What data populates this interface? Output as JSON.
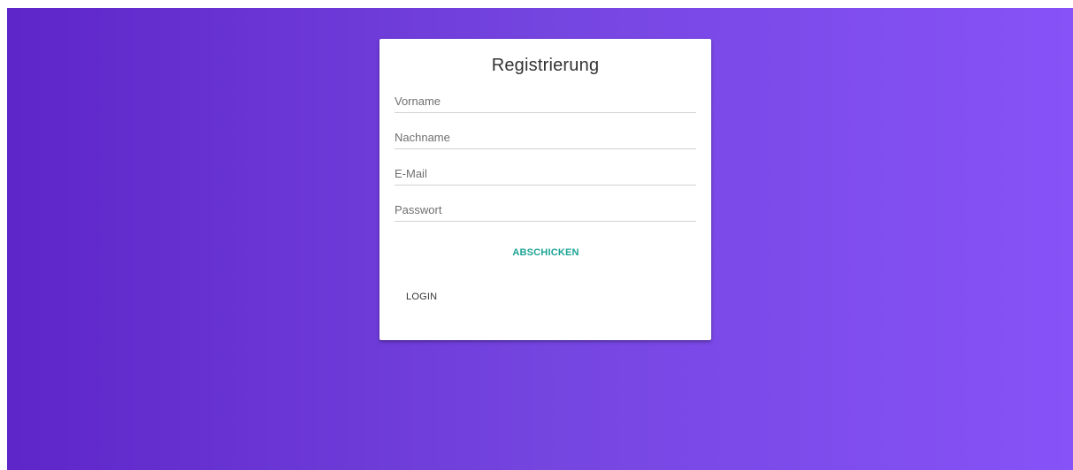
{
  "form": {
    "title": "Registrierung",
    "fields": [
      {
        "placeholder": "Vorname",
        "value": ""
      },
      {
        "placeholder": "Nachname",
        "value": ""
      },
      {
        "placeholder": "E-Mail",
        "value": ""
      },
      {
        "placeholder": "Passwort",
        "value": ""
      }
    ],
    "submit_label": "ABSCHICKEN",
    "login_label": "LOGIN"
  },
  "colors": {
    "gradient_start": "#5e25c8",
    "gradient_end": "#8752f7",
    "accent": "#1ca394",
    "card_background": "#ffffff"
  }
}
